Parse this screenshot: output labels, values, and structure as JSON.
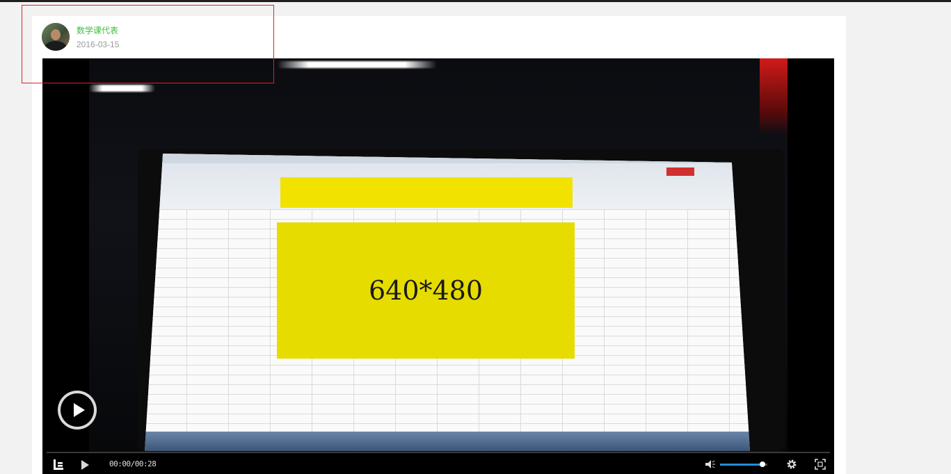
{
  "post": {
    "author_name": "数学课代表",
    "date": "2016-03-15",
    "avatar_icon": "user-avatar"
  },
  "video": {
    "frame_text": "640*480",
    "highlight_color": "#e02020"
  },
  "player": {
    "time_display": "00:00/00:28",
    "volume_level": 0.9,
    "progress": 0.0,
    "accent_color": "#1e90d8",
    "icons": {
      "logo": "letv-logo-icon",
      "play_overlay": "play-circle-icon",
      "play": "play-icon",
      "volume": "volume-icon",
      "settings": "gear-icon",
      "fullscreen": "fullscreen-icon"
    }
  }
}
